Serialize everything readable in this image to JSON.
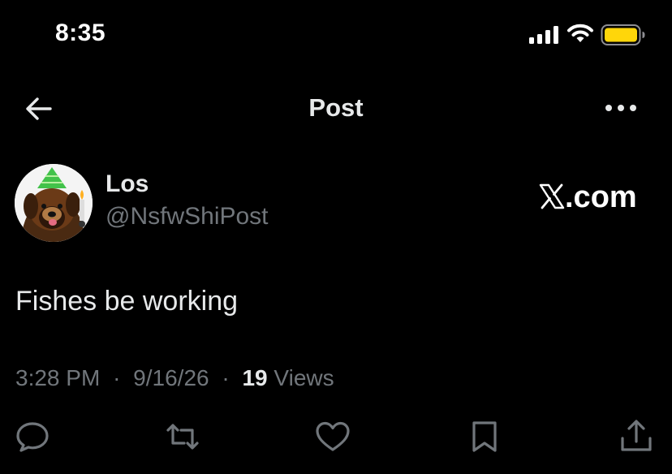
{
  "status_bar": {
    "time": "8:35",
    "icons": [
      "signal-icon",
      "wifi-icon",
      "battery-icon"
    ],
    "battery_color": "#ffd60a"
  },
  "nav": {
    "title": "Post",
    "back_icon": "arrow-left-icon",
    "more_icon": "more-horizontal-icon"
  },
  "author": {
    "display_name": "Los",
    "handle": "@NsfwShiPost",
    "avatar": "dog-avatar-with-party-hat"
  },
  "watermark": {
    "x_glyph": "𝕏",
    "text": ".com"
  },
  "post": {
    "text": "Fishes be working"
  },
  "meta": {
    "time": "3:28 PM",
    "separator": "·",
    "date": "9/16/26",
    "views_count": "19",
    "views_label": "Views"
  },
  "actions": [
    {
      "name": "reply",
      "icon": "reply-icon"
    },
    {
      "name": "repost",
      "icon": "repost-icon"
    },
    {
      "name": "like",
      "icon": "heart-icon"
    },
    {
      "name": "bookmark",
      "icon": "bookmark-icon"
    },
    {
      "name": "share",
      "icon": "share-icon"
    }
  ],
  "colors": {
    "background": "#000000",
    "text_primary": "#e7e9ea",
    "text_secondary": "#71767b"
  }
}
